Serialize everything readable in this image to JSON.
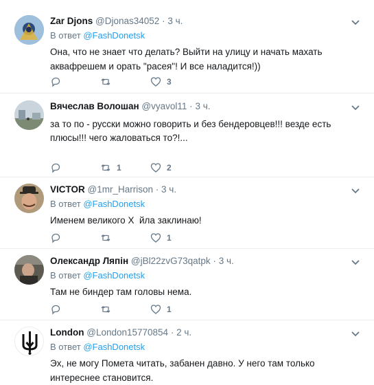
{
  "reply_prefix": "В ответ",
  "tweets": [
    {
      "name": "Zar Djons",
      "handle": "@Djonas34052",
      "dot": "·",
      "time": "3 ч.",
      "reply_link": "@FashDonetsk",
      "text": "Она, что не знает что делать? Выйти на улицу и начать махать аквафрешем и орать \"расея\"! И все наладится!))",
      "retweets": "",
      "likes": "3"
    },
    {
      "name": "Вячеслав Волошан",
      "handle": "@vyavol11",
      "dot": "·",
      "time": "3 ч.",
      "reply_link": "",
      "text": "за то по - русски можно говорить и без бендеровцев!!! везде есть плюсы!!! чего жаловаться то?!...",
      "retweets": "1",
      "likes": "2"
    },
    {
      "name": "VICTOR",
      "handle": "@1mr_Harrison",
      "dot": "·",
      "time": "3 ч.",
      "reply_link": "@FashDonetsk",
      "text": "Именем великого Х  йла заклинаю!",
      "retweets": "",
      "likes": "1"
    },
    {
      "name": "Олександр Ляпін",
      "handle": "@jBl22zvG73qatpk",
      "dot": "·",
      "time": "3 ч.",
      "reply_link": "@FashDonetsk",
      "text": "Там не биндер там головы нема.",
      "retweets": "",
      "likes": "1"
    },
    {
      "name": "London",
      "handle": "@London15770854",
      "dot": "·",
      "time": "2 ч.",
      "reply_link": "@FashDonetsk",
      "text": "Эх, не могу Помета читать, забанен давно. У него там только интереснее становится.",
      "retweets": "",
      "likes": ""
    }
  ]
}
